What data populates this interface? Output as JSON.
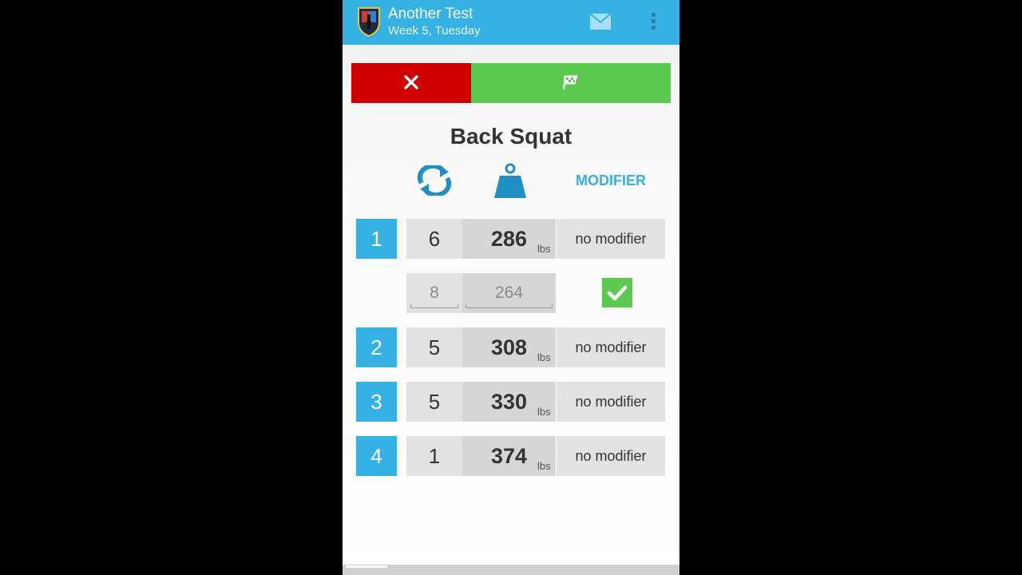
{
  "header": {
    "title": "Another Test",
    "subtitle": "Week 5, Tuesday",
    "logo_icon": "app-shield-logo",
    "mail_icon": "mail-icon",
    "overflow_icon": "overflow-menu-icon",
    "background_color": "#35b2e3"
  },
  "actions": {
    "cancel_icon": "close-icon",
    "cancel_color": "#d00000",
    "finish_icon": "checkered-flag-icon",
    "finish_color": "#5bc84e"
  },
  "exercise": {
    "name": "Back Squat",
    "columns": {
      "reps_icon": "repeat-arrows-icon",
      "weight_icon": "kettlebell-weight-icon",
      "modifier_label": "MODIFIER"
    },
    "unit": "lbs",
    "sets": [
      {
        "number": "1",
        "reps": "6",
        "weight": "286",
        "modifier": "no modifier"
      },
      {
        "number": "2",
        "reps": "5",
        "weight": "308",
        "modifier": "no modifier"
      },
      {
        "number": "3",
        "reps": "5",
        "weight": "330",
        "modifier": "no modifier"
      },
      {
        "number": "4",
        "reps": "1",
        "weight": "374",
        "modifier": "no modifier"
      }
    ],
    "current_entry": {
      "reps_placeholder": "8",
      "weight_placeholder": "264",
      "confirm_icon": "checkmark-icon"
    }
  }
}
